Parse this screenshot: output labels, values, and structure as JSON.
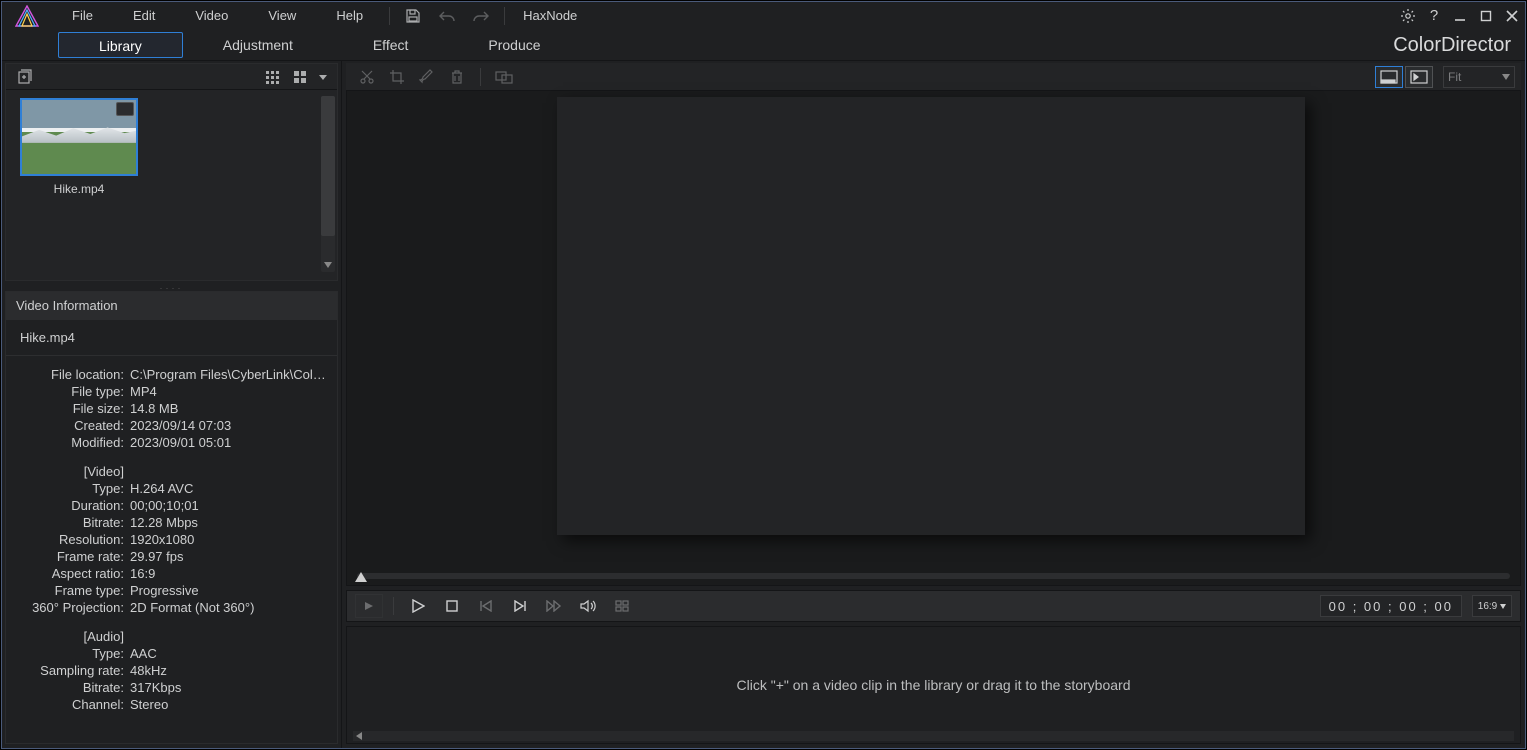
{
  "menubar": {
    "items": [
      "File",
      "Edit",
      "Video",
      "View",
      "Help"
    ],
    "extra": "HaxNode"
  },
  "brand": "ColorDirector",
  "tabs": [
    {
      "label": "Library",
      "active": true
    },
    {
      "label": "Adjustment",
      "active": false
    },
    {
      "label": "Effect",
      "active": false
    },
    {
      "label": "Produce",
      "active": false
    }
  ],
  "library": {
    "thumb_name": "Hike.mp4"
  },
  "info": {
    "panel_title": "Video Information",
    "filename": "Hike.mp4",
    "rows": [
      {
        "k": "File location:",
        "v": "C:\\Program Files\\CyberLink\\Color..."
      },
      {
        "k": "File type:",
        "v": "MP4"
      },
      {
        "k": "File size:",
        "v": "14.8 MB"
      },
      {
        "k": "Created:",
        "v": "2023/09/14 07:03"
      },
      {
        "k": "Modified:",
        "v": "2023/09/01 05:01"
      }
    ],
    "video_section": "[Video]",
    "video_rows": [
      {
        "k": "Type:",
        "v": "H.264 AVC"
      },
      {
        "k": "Duration:",
        "v": "00;00;10;01"
      },
      {
        "k": "Bitrate:",
        "v": "12.28 Mbps"
      },
      {
        "k": "Resolution:",
        "v": "1920x1080"
      },
      {
        "k": "Frame rate:",
        "v": "29.97 fps"
      },
      {
        "k": "Aspect ratio:",
        "v": "16:9"
      },
      {
        "k": "Frame type:",
        "v": "Progressive"
      },
      {
        "k": "360° Projection:",
        "v": "2D Format (Not 360°)"
      }
    ],
    "audio_section": "[Audio]",
    "audio_rows": [
      {
        "k": "Type:",
        "v": "AAC"
      },
      {
        "k": "Sampling rate:",
        "v": "48kHz"
      },
      {
        "k": "Bitrate:",
        "v": "317Kbps"
      },
      {
        "k": "Channel:",
        "v": "Stereo"
      }
    ]
  },
  "preview": {
    "zoom_label": "Fit"
  },
  "controls": {
    "timecode": "00 ; 00 ; 00 ; 00",
    "aspect": "16:9"
  },
  "storyboard": {
    "hint": "Click \"+\" on a video clip in the library or drag it to the storyboard"
  }
}
